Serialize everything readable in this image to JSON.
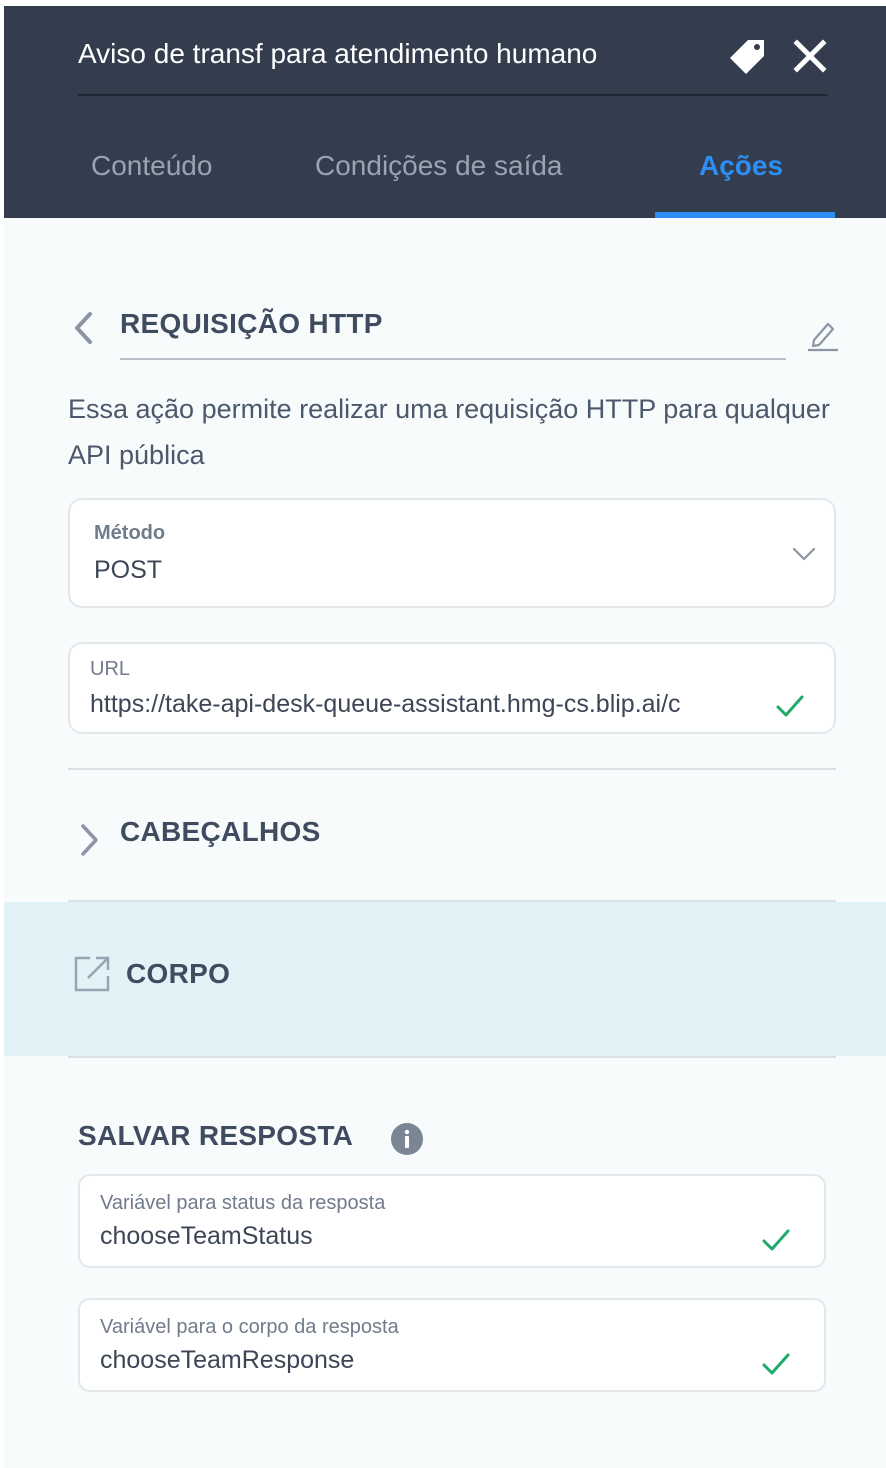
{
  "header": {
    "title": "Aviso de transf para atendimento humano",
    "tag_icon": "tag-icon",
    "close_icon": "close-icon"
  },
  "tabs": [
    {
      "label": "Conteúdo",
      "active": false
    },
    {
      "label": "Condições de saída",
      "active": false
    },
    {
      "label": "Ações",
      "active": true
    }
  ],
  "action": {
    "title": "REQUISIÇÃO HTTP",
    "description": "Essa ação permite realizar uma requisição HTTP para qualquer API pública"
  },
  "method_field": {
    "label": "Método",
    "value": "POST"
  },
  "url_field": {
    "label": "URL",
    "value": "https://take-api-desk-queue-assistant.hmg-cs.blip.ai/c"
  },
  "sections": {
    "headers": "CABEÇALHOS",
    "body": "CORPO",
    "save_response": "SALVAR RESPOSTA"
  },
  "status_var": {
    "label": "Variável para status da resposta",
    "value": "chooseTeamStatus"
  },
  "body_var": {
    "label": "Variável para o corpo da resposta",
    "value": "chooseTeamResponse"
  },
  "colors": {
    "header_bg": "#333d4d",
    "accent": "#2d8ef5",
    "valid_check": "#1fa96b",
    "highlight_row": "#e1f3f7"
  }
}
